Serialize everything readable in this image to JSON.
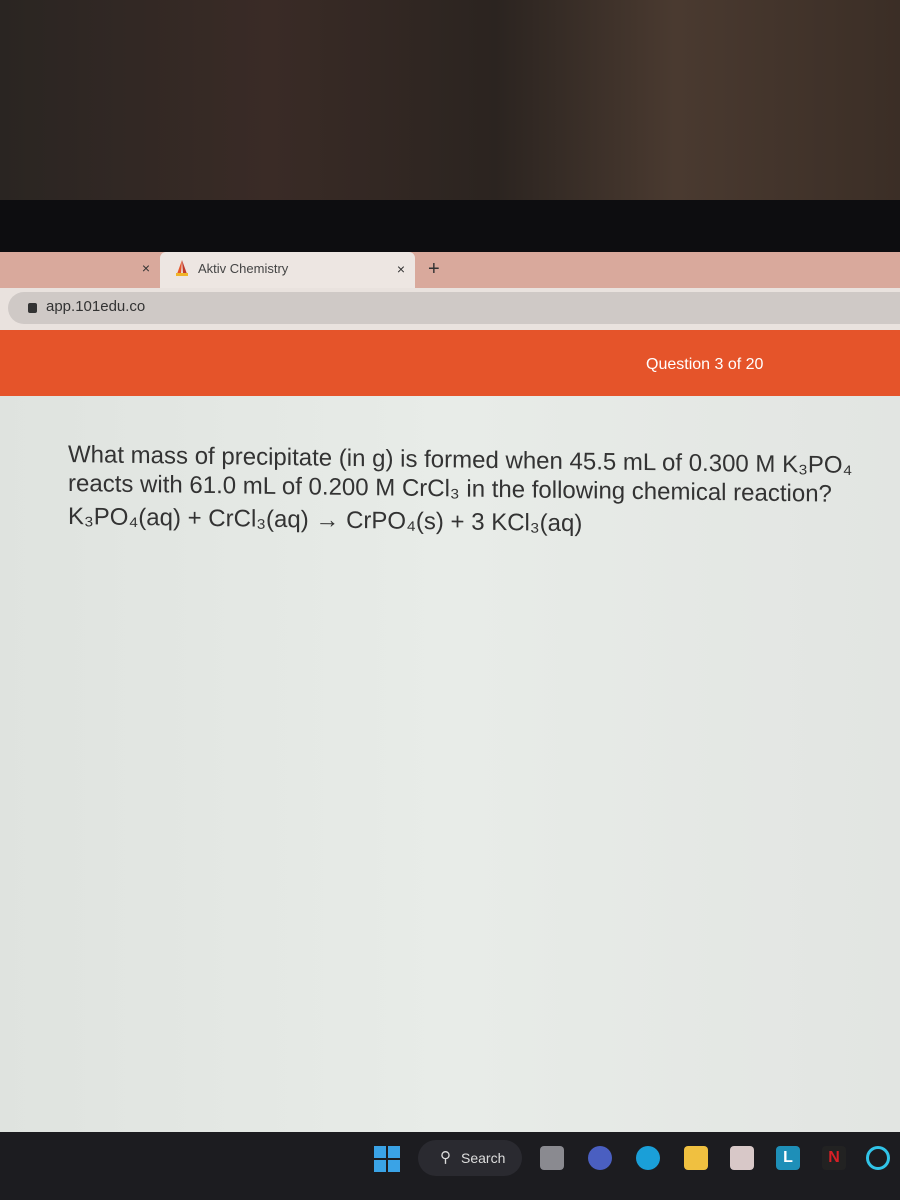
{
  "browser": {
    "tabs": [
      {
        "label": "",
        "close": "×"
      },
      {
        "label": "Aktiv Chemistry",
        "close": "×",
        "active": true
      }
    ],
    "new_tab": "+",
    "url": "app.101edu.co"
  },
  "header": {
    "question_counter": "Question 3 of 20",
    "color": "#e5542a"
  },
  "question": {
    "text": "What mass of precipitate (in g) is formed when 45.5 mL of 0.300 M K₃PO₄ reacts with 61.0 mL of 0.200 M CrCl₃ in the following chemical reaction?",
    "equation": "K₃PO₄(aq) + CrCl₃(aq) → CrPO₄(s) + 3 KCl₃(aq)"
  },
  "taskbar": {
    "search_label": "Search",
    "icons": [
      "windows-start-icon",
      "task-view-icon",
      "meet-icon",
      "edge-icon",
      "file-explorer-icon",
      "store-icon",
      "l-app-icon",
      "netflix-icon",
      "alexa-icon"
    ]
  }
}
